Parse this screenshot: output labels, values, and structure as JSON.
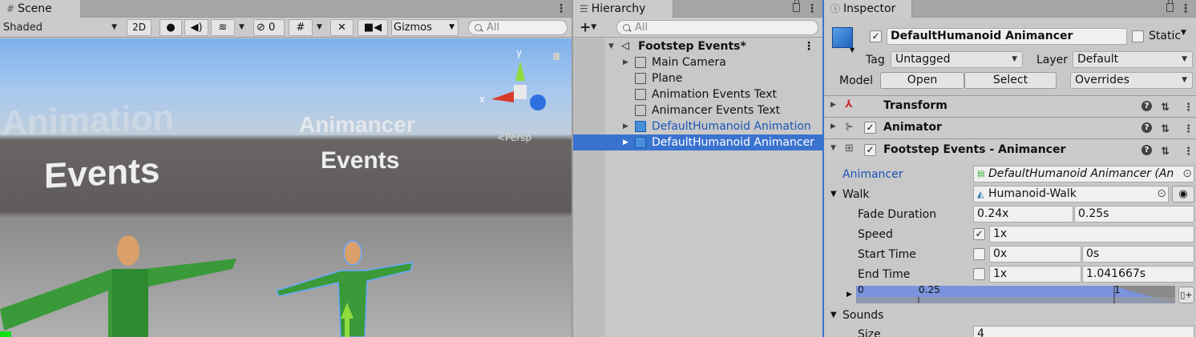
{
  "scene": {
    "tab_label": "Scene",
    "shading_mode": "Shaded",
    "mode_2d": "2D",
    "hidden_count": "0",
    "gizmos_label": "Gizmos",
    "search_placeholder": "All",
    "viewport": {
      "text_animation": "Animation",
      "text_events_left": "Events",
      "text_animancer": "Animancer",
      "text_events_right": "Events",
      "persp_label": "<Persp",
      "axis_x": "x",
      "axis_y": "y"
    }
  },
  "hierarchy": {
    "tab_label": "Hierarchy",
    "search_placeholder": "All",
    "scene_name": "Footstep Events*",
    "items": [
      {
        "label": "Main Camera",
        "expandable": true,
        "prefab": false,
        "selected": false
      },
      {
        "label": "Plane",
        "expandable": false,
        "prefab": false,
        "selected": false
      },
      {
        "label": "Animation Events Text",
        "expandable": false,
        "prefab": false,
        "selected": false
      },
      {
        "label": "Animancer Events Text",
        "expandable": false,
        "prefab": false,
        "selected": false
      },
      {
        "label": "DefaultHumanoid Animation",
        "expandable": true,
        "prefab": true,
        "selected": false
      },
      {
        "label": "DefaultHumanoid Animancer",
        "expandable": true,
        "prefab": true,
        "selected": true
      }
    ]
  },
  "inspector": {
    "tab_label": "Inspector",
    "object_name": "DefaultHumanoid Animancer",
    "static_label": "Static",
    "tag_label": "Tag",
    "tag_value": "Untagged",
    "layer_label": "Layer",
    "layer_value": "Default",
    "model_label": "Model",
    "open_button": "Open",
    "select_button": "Select",
    "overrides_value": "Overrides",
    "components": [
      {
        "title": "Transform"
      },
      {
        "title": "Animator"
      },
      {
        "title": "Footstep Events - Animancer"
      }
    ],
    "animancer_label": "Animancer",
    "animancer_value": "DefaultHumanoid Animancer (An",
    "walk_label": "Walk",
    "walk_value": "Humanoid-Walk",
    "fade_label": "Fade Duration",
    "fade_a": "0.24x",
    "fade_b": "0.25s",
    "speed_label": "Speed",
    "speed_value": "1x",
    "start_label": "Start Time",
    "start_a": "0x",
    "start_b": "0s",
    "end_label": "End Time",
    "end_a": "1x",
    "end_b": "1.041667s",
    "timeline_start": "0",
    "timeline_mid": "0.25",
    "timeline_end": "1",
    "sounds_label": "Sounds",
    "size_label": "Size",
    "size_value": "4"
  },
  "colors": {
    "selection": "#3a72d0",
    "link_text": "#1b56b8",
    "header_bg": "#a5a5a5",
    "panel_bg": "#c8c8c8"
  }
}
